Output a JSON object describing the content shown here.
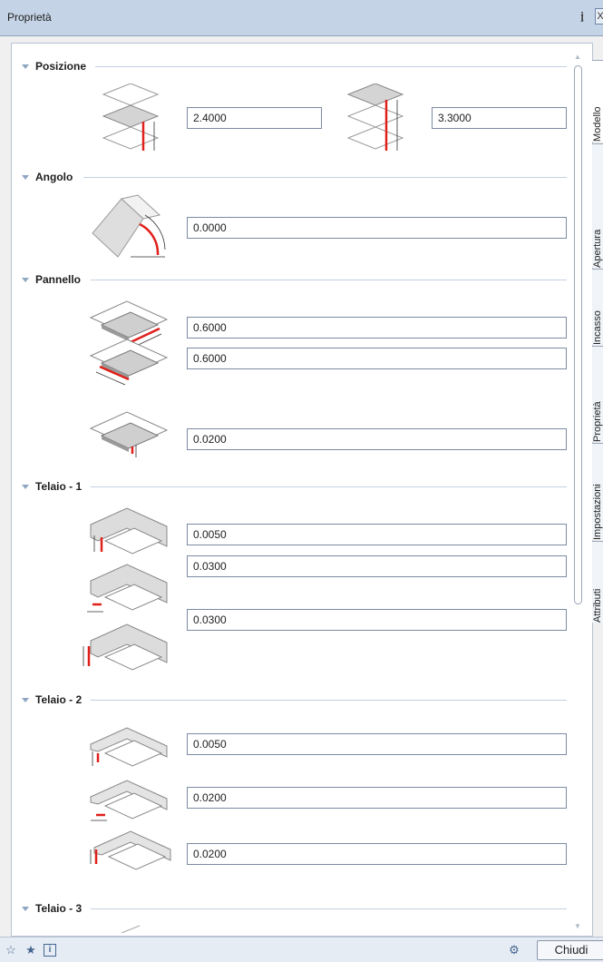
{
  "window": {
    "title": "Proprietà",
    "pin_icon": "pin-icon",
    "close_icon": "close-icon",
    "close_glyph": "X"
  },
  "groups": [
    {
      "label": "Posizione",
      "fields": [
        "2.4000",
        "3.3000"
      ]
    },
    {
      "label": "Angolo",
      "fields": [
        "0.0000"
      ]
    },
    {
      "label": "Pannello",
      "fields": [
        "0.6000",
        "0.6000",
        "0.0200"
      ]
    },
    {
      "label": "Telaio - 1",
      "fields": [
        "0.0050",
        "0.0300",
        "0.0300"
      ]
    },
    {
      "label": "Telaio - 2",
      "fields": [
        "0.0050",
        "0.0200",
        "0.0200"
      ]
    },
    {
      "label": "Telaio - 3",
      "fields": []
    }
  ],
  "tabs": [
    "Modello",
    "Apertura",
    "Incasso",
    "Proprietà",
    "Impostazioni",
    "Attributi"
  ],
  "bottom": {
    "close_label": "Chiudi",
    "icons": [
      "favorite-open-icon",
      "favorite-save-icon",
      "info-icon",
      "settings-icon"
    ]
  },
  "colors": {
    "accent_red": "#e0201b",
    "header_line": "#c3d0e0",
    "titlebar": "#c4d3e6"
  }
}
